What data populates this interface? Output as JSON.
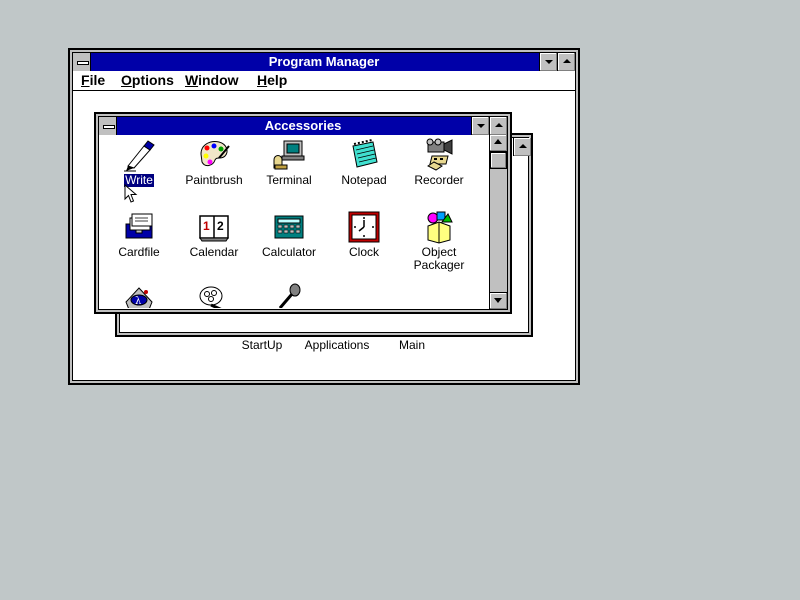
{
  "program_manager": {
    "title": "Program Manager",
    "menu": [
      {
        "label": "File",
        "mnemonic": "F",
        "rest": "ile"
      },
      {
        "label": "Options",
        "mnemonic": "O",
        "rest": "ptions"
      },
      {
        "label": "Window",
        "mnemonic": "W",
        "rest": "indow"
      },
      {
        "label": "Help",
        "mnemonic": "H",
        "rest": "elp"
      }
    ],
    "group_icons": [
      {
        "label": "StartUp"
      },
      {
        "label": "Applications"
      },
      {
        "label": "Main"
      }
    ]
  },
  "accessories": {
    "title": "Accessories",
    "items": [
      {
        "label": "Write",
        "icon": "write-icon",
        "selected": true
      },
      {
        "label": "Paintbrush",
        "icon": "paintbrush-icon"
      },
      {
        "label": "Terminal",
        "icon": "terminal-icon"
      },
      {
        "label": "Notepad",
        "icon": "notepad-icon"
      },
      {
        "label": "Recorder",
        "icon": "recorder-icon"
      },
      {
        "label": "Cardfile",
        "icon": "cardfile-icon"
      },
      {
        "label": "Calendar",
        "icon": "calendar-icon"
      },
      {
        "label": "Calculator",
        "icon": "calculator-icon"
      },
      {
        "label": "Clock",
        "icon": "clock-icon"
      },
      {
        "label": "Object Packager",
        "line1": "Object",
        "line2": "Packager",
        "icon": "object-packager-icon"
      },
      {
        "label": "",
        "icon": "character-map-icon"
      },
      {
        "label": "",
        "icon": "media-player-icon"
      },
      {
        "label": "",
        "icon": "sound-recorder-icon"
      }
    ]
  },
  "colors": {
    "desktop": "#c0c7c8",
    "titlebar_active": "#0000a8",
    "selection": "#000080"
  }
}
